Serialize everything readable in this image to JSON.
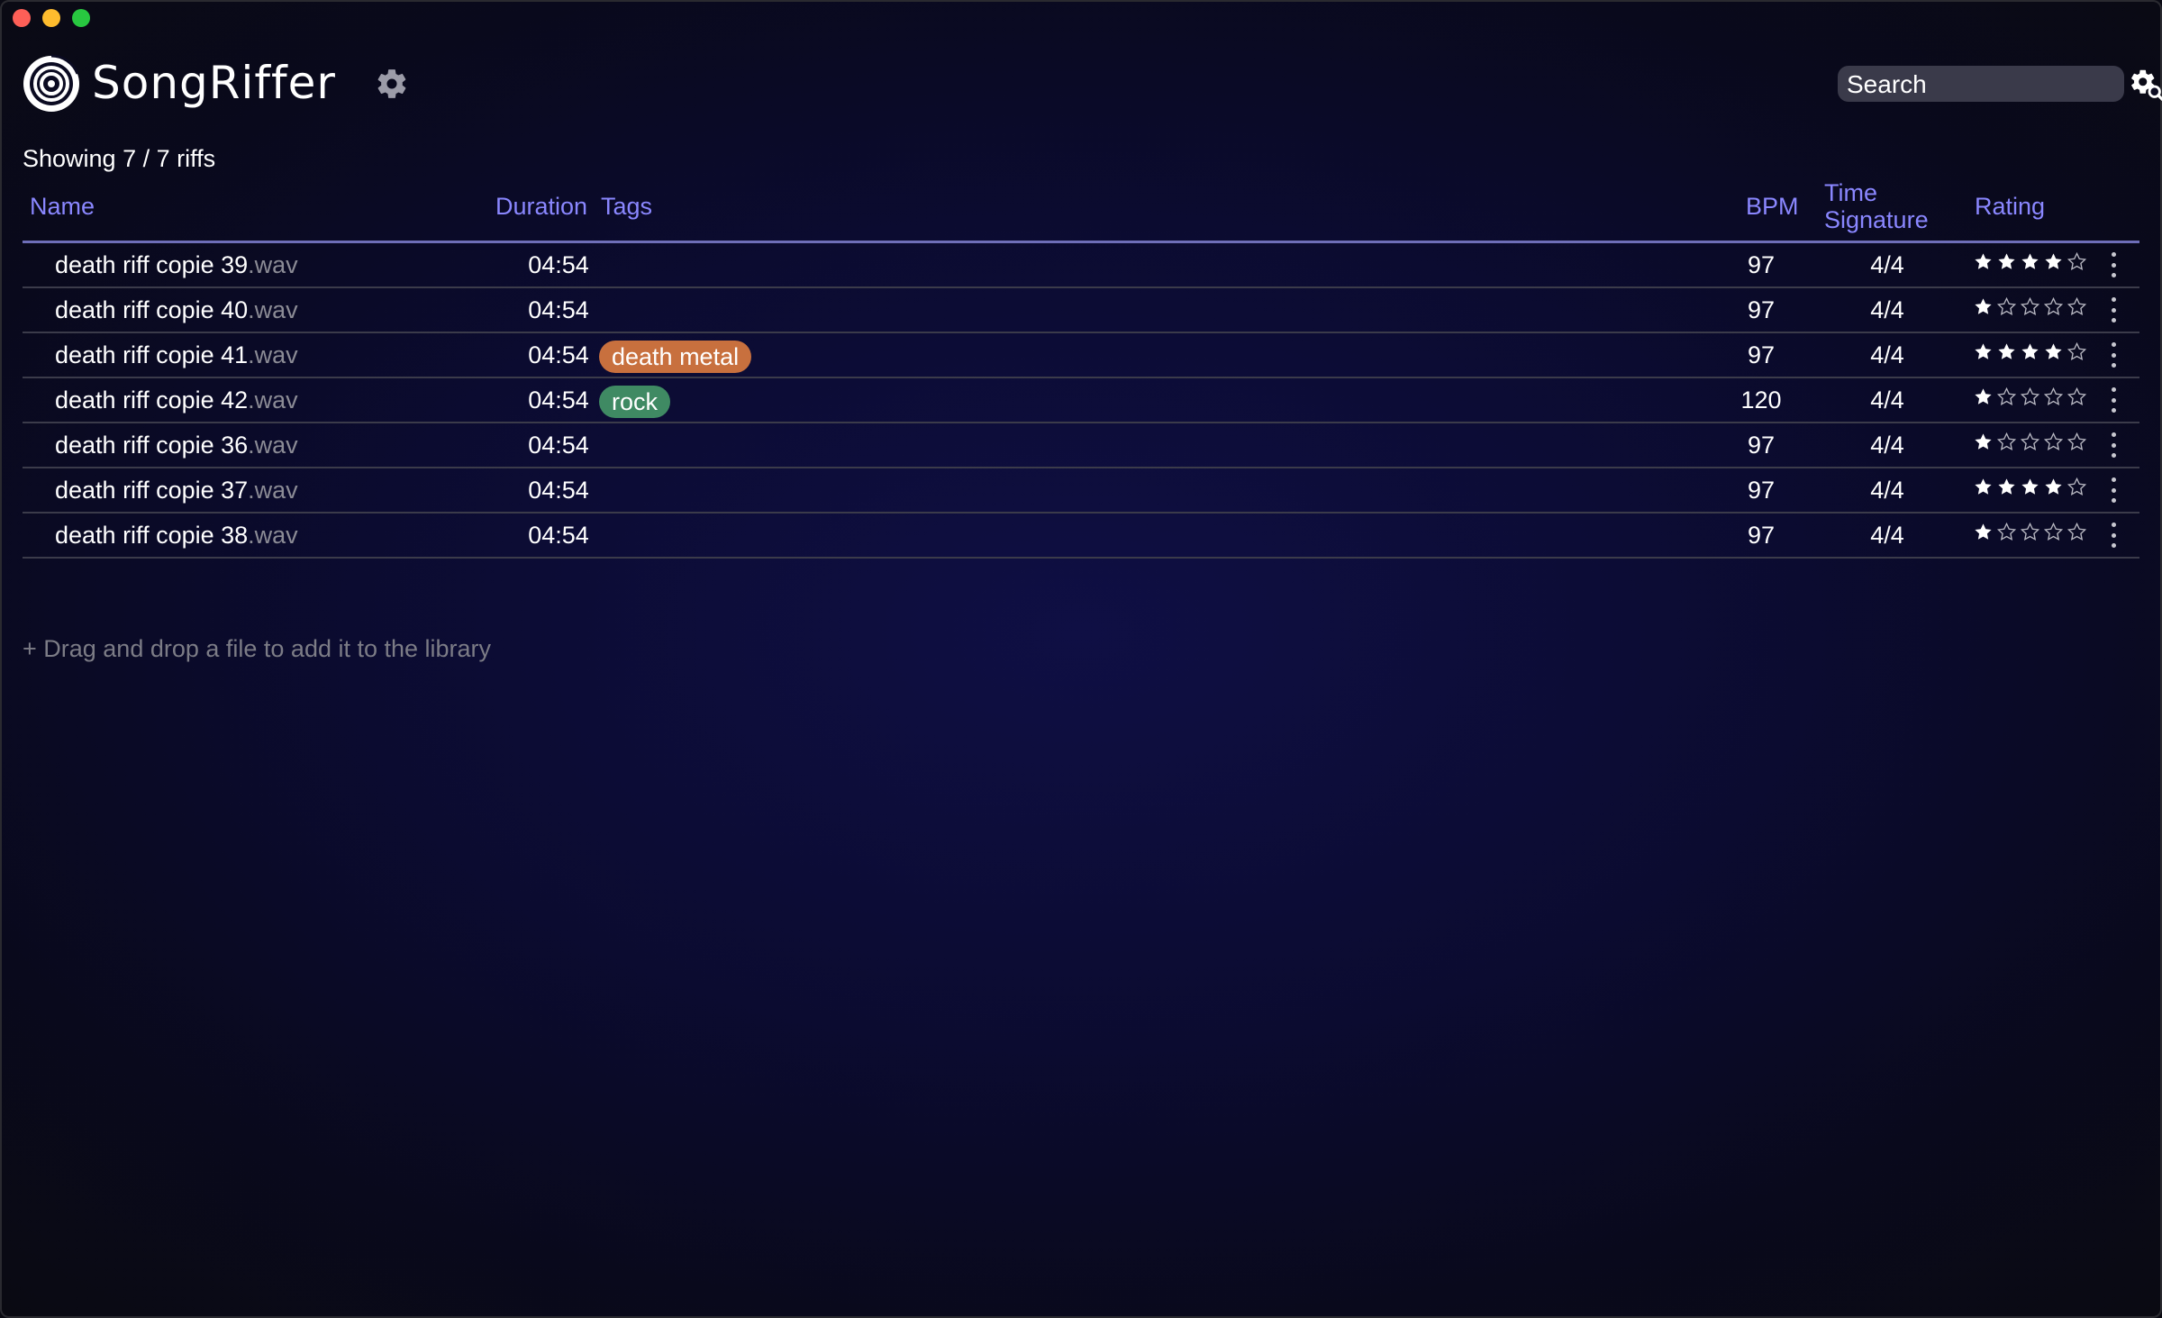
{
  "app": {
    "name": "SongRiffer"
  },
  "header": {
    "search_placeholder": "Search"
  },
  "status": {
    "showing": "Showing 7 / 7 riffs"
  },
  "columns": {
    "name": "Name",
    "duration": "Duration",
    "tags": "Tags",
    "bpm": "BPM",
    "time_signature_line1": "Time",
    "time_signature_line2": "Signature",
    "rating": "Rating"
  },
  "rows": [
    {
      "name": "death riff copie 39",
      "ext": ".wav",
      "duration": "04:54",
      "tags": [],
      "bpm": "97",
      "time_signature": "4/4",
      "rating": 4
    },
    {
      "name": "death riff copie 40",
      "ext": ".wav",
      "duration": "04:54",
      "tags": [],
      "bpm": "97",
      "time_signature": "4/4",
      "rating": 1
    },
    {
      "name": "death riff copie 41",
      "ext": ".wav",
      "duration": "04:54",
      "tags": [
        {
          "label": "death metal",
          "color": "#c8703e"
        }
      ],
      "bpm": "97",
      "time_signature": "4/4",
      "rating": 4
    },
    {
      "name": "death riff copie 42",
      "ext": ".wav",
      "duration": "04:54",
      "tags": [
        {
          "label": "rock",
          "color": "#3f8a63"
        }
      ],
      "bpm": "120",
      "time_signature": "4/4",
      "rating": 1
    },
    {
      "name": "death riff copie 36",
      "ext": ".wav",
      "duration": "04:54",
      "tags": [],
      "bpm": "97",
      "time_signature": "4/4",
      "rating": 1
    },
    {
      "name": "death riff copie 37",
      "ext": ".wav",
      "duration": "04:54",
      "tags": [],
      "bpm": "97",
      "time_signature": "4/4",
      "rating": 4
    },
    {
      "name": "death riff copie 38",
      "ext": ".wav",
      "duration": "04:54",
      "tags": [],
      "bpm": "97",
      "time_signature": "4/4",
      "rating": 1
    }
  ],
  "rating_max": 5,
  "drop_hint": "+ Drag and drop a file to add it to the library",
  "icons": {
    "logo": "songriffer-logo-icon",
    "settings": "gear-icon",
    "advanced_search": "gear-search-icon",
    "row_menu": "vertical-ellipsis-icon",
    "star_filled": "star-filled-icon",
    "star_empty": "star-outline-icon"
  },
  "colors": {
    "header_text": "#8a87ff",
    "tag_death_metal": "#c8703e",
    "tag_rock": "#3f8a63"
  }
}
